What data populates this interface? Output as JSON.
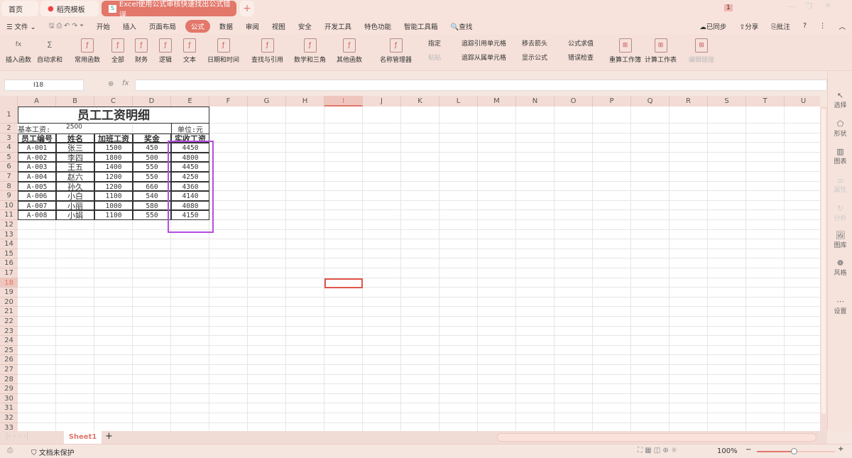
{
  "tabs": [
    {
      "label": "首页"
    },
    {
      "label": "稻壳模板"
    },
    {
      "label": "Excel使用公式审核快速找出公式错误"
    }
  ],
  "notif_count": "1",
  "menu": {
    "file": "文件",
    "items": [
      "开始",
      "插入",
      "页面布局",
      "公式",
      "数据",
      "审阅",
      "视图",
      "安全",
      "开发工具",
      "特色功能",
      "智能工具箱"
    ],
    "active": "公式",
    "search": "查找",
    "sync": "已同步",
    "share": "分享",
    "comment": "批注"
  },
  "ribbon": {
    "big": [
      "插入函数",
      "自动求和",
      "常用函数",
      "全部",
      "财务",
      "逻辑",
      "文本",
      "日期和时间",
      "查找与引用",
      "数学和三角",
      "其他函数",
      "名称管理器"
    ],
    "small": [
      "指定",
      "粘贴",
      "追踪引用单元格",
      "追踪从属单元格",
      "移去箭头",
      "显示公式",
      "公式求值",
      "错误检查"
    ],
    "big2": [
      "重算工作簿",
      "计算工作表",
      "编辑链接"
    ]
  },
  "formula_bar": {
    "name_box": "I18",
    "fx": "fx",
    "value": ""
  },
  "columns": [
    "A",
    "B",
    "C",
    "D",
    "E",
    "F",
    "G",
    "H",
    "I",
    "J",
    "K",
    "L",
    "M",
    "N",
    "O",
    "P",
    "Q",
    "R",
    "S",
    "T",
    "U"
  ],
  "row_count": 33,
  "selected_cell": "I18",
  "sheet": {
    "title": "员工工资明细",
    "base_label": "基本工资:",
    "base_value": "2500",
    "unit": "单位:元",
    "headers": [
      "员工编号",
      "姓名",
      "加班工资",
      "奖金",
      "实收工资"
    ],
    "rows": [
      [
        "A-001",
        "张三",
        "1500",
        "450",
        "4450"
      ],
      [
        "A-002",
        "李四",
        "1800",
        "500",
        "4800"
      ],
      [
        "A-003",
        "王五",
        "1400",
        "550",
        "4450"
      ],
      [
        "A-004",
        "赵六",
        "1200",
        "550",
        "4250"
      ],
      [
        "A-005",
        "孙久",
        "1200",
        "660",
        "4360"
      ],
      [
        "A-006",
        "小白",
        "1100",
        "540",
        "4140"
      ],
      [
        "A-007",
        "小丽",
        "1000",
        "580",
        "4080"
      ],
      [
        "A-008",
        "小娟",
        "1100",
        "550",
        "4150"
      ]
    ]
  },
  "sidebar": [
    "选择",
    "形状",
    "图表",
    "属性",
    "分析",
    "图库",
    "风格",
    "设置"
  ],
  "sheet_tab": "Sheet1",
  "status": {
    "protect": "文档未保护",
    "zoom": "100%"
  },
  "colors": {
    "accent": "#e2776a",
    "highlight": "#b44de0"
  }
}
